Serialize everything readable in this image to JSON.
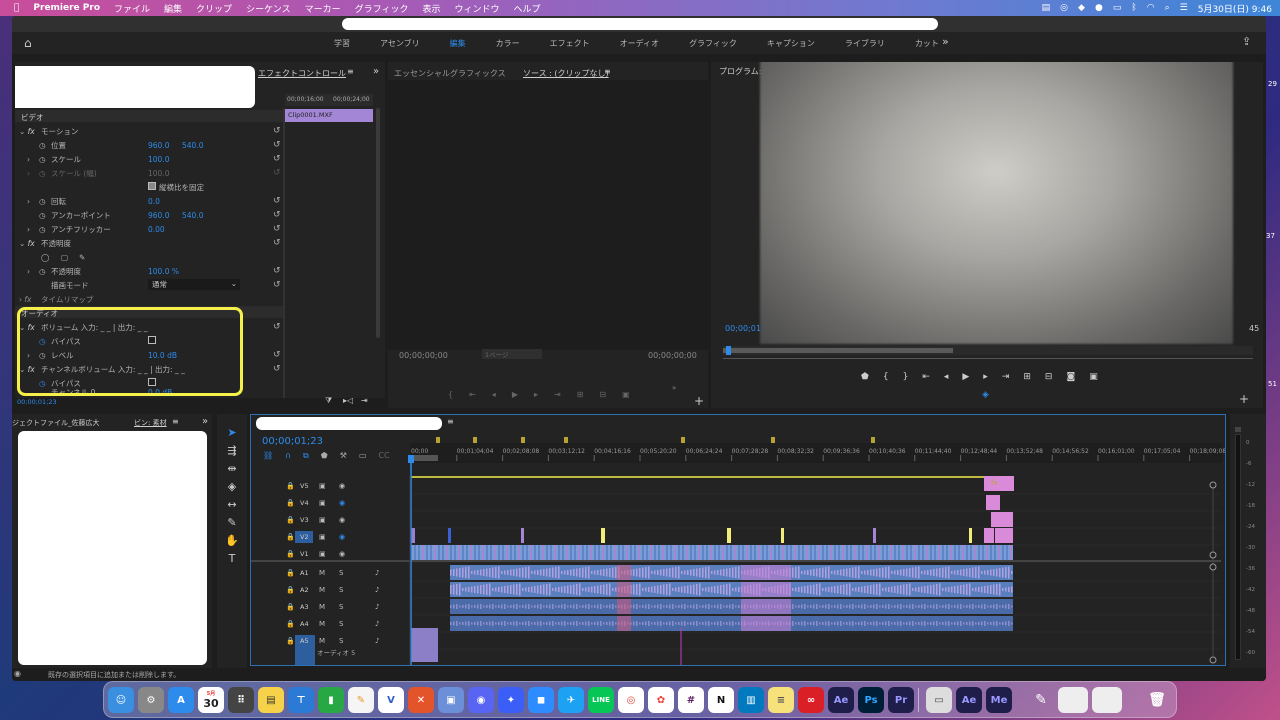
{
  "menubar": {
    "app": "Premiere Pro",
    "items": [
      "ファイル",
      "編集",
      "クリップ",
      "シーケンス",
      "マーカー",
      "グラフィック",
      "表示",
      "ウィンドウ",
      "ヘルプ"
    ],
    "clock": "5月30日(日) 9:46"
  },
  "workspaces": [
    "学習",
    "アセンブリ",
    "編集",
    "カラー",
    "エフェクト",
    "オーディオ",
    "グラフィック",
    "キャプション",
    "ライブラリ",
    "カット"
  ],
  "effect_controls": {
    "tab": "エフェクトコントロール",
    "video_header": "ビデオ",
    "motion": "モーション",
    "position": "位置",
    "position_x": "960.0",
    "position_y": "540.0",
    "scale": "スケール",
    "scale_val": "100.0",
    "scale_w": "スケール (幅)",
    "scale_w_val": "100.0",
    "keep_aspect": "縦横比を固定",
    "rotation": "回転",
    "rotation_val": "0.0",
    "anchor": "アンカーポイント",
    "anchor_x": "960.0",
    "anchor_y": "540.0",
    "antiflicker": "アンチフリッカー",
    "antiflicker_val": "0.00",
    "opacity_group": "不透明度",
    "opacity": "不透明度",
    "opacity_val": "100.0 %",
    "blend": "描画モード",
    "blend_val": "通常",
    "timeremap": "タイムリマップ",
    "audio_header": "オーディオ",
    "volume": "ボリューム 入力: _ _ | 出力: _ _",
    "bypass": "バイパス",
    "level": "レベル",
    "level_val": "10.0 dB",
    "channel_volume": "チャンネルボリューム 入力: _ _ | 出力: _ _",
    "bypass2": "バイパス",
    "channel_l": "チャンネル 0",
    "channel_l_val": "0.0 dB",
    "time_a": "00;00;16;00",
    "time_b": "00;00;24;00",
    "clip": "Clip0001.MXF",
    "timecode": "00;00;01;23"
  },
  "source": {
    "tab1": "エッセンシャルグラフィックス",
    "tab2": "ソース : (クリップなし)",
    "tc_left": "00;00;00;00",
    "page": "1ページ",
    "tc_right": "00;00;00;00"
  },
  "program": {
    "tab": "プログラム:",
    "tc_left": "00;00;01",
    "tc_right": "45"
  },
  "project": {
    "tab1": "ジェクトファイル_佐藤広大",
    "tab2": "ビン: 素材",
    "status": "既存の選択項目に追加または削除します。"
  },
  "timeline": {
    "timecode": "00;00;01;23",
    "ruler": [
      "00;00",
      "00;01;04;04",
      "00;02;08;08",
      "00;03;12;12",
      "00;04;16;16",
      "00;05;20;20",
      "00;06;24;24",
      "00;07;28;28",
      "00;08;32;32",
      "00;09;36;36",
      "00;10;40;36",
      "00;11;44;40",
      "00;12;48;44",
      "00;13;52;48",
      "00;14;56;52",
      "00;16;01;00",
      "00;17;05;04",
      "00;18;09;08"
    ],
    "video_tracks": [
      "V5",
      "V4",
      "V3",
      "V2",
      "V1"
    ],
    "audio_tracks": [
      "A1",
      "A2",
      "A3",
      "A4",
      "A5"
    ],
    "a5_name": "オーディオ 5",
    "meter_labels": [
      "0",
      "-6",
      "-12",
      "-18",
      "-24",
      "-30",
      "-36",
      "-42",
      "-48",
      "-54",
      "-60"
    ]
  },
  "dock": {
    "calendar_day": "30",
    "calendar_month": "5月"
  }
}
